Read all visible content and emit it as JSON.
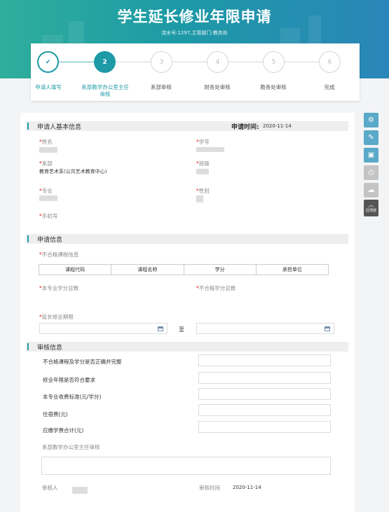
{
  "header": {
    "title": "学生延长修业年限申请",
    "subtitle": "流水号:1297,主管部门:教务处"
  },
  "steps": [
    {
      "label": "申请人填写",
      "num": "✔",
      "state": "done"
    },
    {
      "label": "系部教学办公室主任审核",
      "num": "2",
      "state": "active"
    },
    {
      "label": "系部审核",
      "num": "3",
      "state": "pending"
    },
    {
      "label": "财务处审核",
      "num": "4",
      "state": "pending"
    },
    {
      "label": "教务处审核",
      "num": "5",
      "state": "pending"
    },
    {
      "label": "完成",
      "num": "6",
      "state": "pending"
    }
  ],
  "basic": {
    "section_title": "申请人基本信息",
    "apply_time_label": "申请时间:",
    "apply_time": "2020-11-14",
    "name_label": "姓名",
    "student_no_label": "学号",
    "dept_label": "系部",
    "dept_value": "教育艺术系(公共艺术教育中心)",
    "class_label": "班级",
    "major_label": "专业",
    "gender_label": "性别",
    "phone_label": "手机号"
  },
  "apply": {
    "section_title": "申请信息",
    "failed_courses_label": "不合格课程信息",
    "table_headers": [
      "课程代码",
      "课程名称",
      "学分",
      "承担单位"
    ],
    "major_credits_label": "本专业学分总数",
    "failed_credits_label": "不合格学分总数",
    "extend_label": "延长修业期限",
    "to_label": "至"
  },
  "review": {
    "section_title": "审核信息",
    "rows": [
      "不合格课程及学分是否正确并完整",
      "修业年限是否符合要求",
      "本专业收费标准(元/学分)",
      "住宿费(元)",
      "应缴学费合计(元)"
    ],
    "opinion_label": "系部教学办公室主任审核",
    "reviewer_label": "审核人",
    "review_time_label": "审核时间",
    "review_time": "2020-11-14"
  },
  "sidebar": {
    "buttons": [
      "流程",
      "编辑",
      "保存",
      "打印",
      "上传"
    ],
    "top_label": "回顶部"
  },
  "colors": {
    "accent": "#1d9aa6",
    "required": "#e02020",
    "side_button": "#5aa9c8"
  }
}
